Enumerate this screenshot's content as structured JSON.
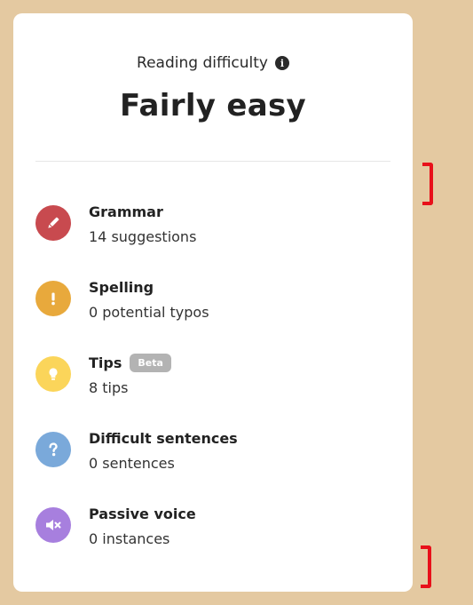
{
  "readability": {
    "label": "Reading difficulty",
    "value": "Fairly easy"
  },
  "metrics": [
    {
      "title": "Grammar",
      "subtitle": "14 suggestions",
      "icon": "pencil-icon",
      "color": "#c84a4f"
    },
    {
      "title": "Spelling",
      "subtitle": "0 potential typos",
      "icon": "exclamation-icon",
      "color": "#e8a93c"
    },
    {
      "title": "Tips",
      "badge": "Beta",
      "subtitle": "8 tips",
      "icon": "lightbulb-icon",
      "color": "#fbd55a"
    },
    {
      "title": "Difficult sentences",
      "subtitle": "0 sentences",
      "icon": "question-icon",
      "color": "#7aa9da"
    },
    {
      "title": "Passive voice",
      "subtitle": "0 instances",
      "icon": "muted-speaker-icon",
      "color": "#a77fde"
    }
  ],
  "colors": {
    "background": "#e4c9a1",
    "card": "#ffffff",
    "annotation_marker": "#e8101a"
  }
}
